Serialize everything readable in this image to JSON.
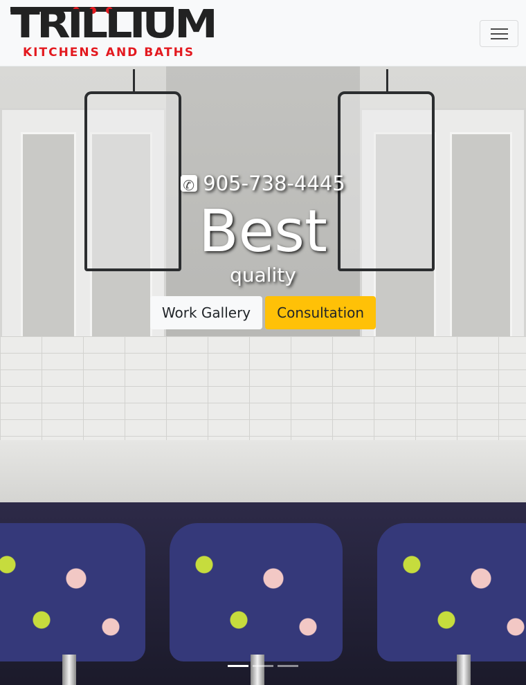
{
  "brand": {
    "logo_word": "TRILLIUM",
    "logo_sub": "KITCHENS AND BATHS",
    "accent_color": "#e3191f"
  },
  "navbar": {
    "toggler_icon": "hamburger-icon"
  },
  "hero": {
    "phone_icon": "phone-square-icon",
    "phone": "905-738-4445",
    "headline": "Best",
    "subheadline": "quality",
    "buttons": {
      "gallery": "Work Gallery",
      "consultation": "Consultation"
    },
    "carousel": {
      "slides": 3,
      "active_slide": 1
    }
  },
  "colors": {
    "consultation_button": "#ffc107",
    "gallery_button": "#f8f9fa"
  }
}
